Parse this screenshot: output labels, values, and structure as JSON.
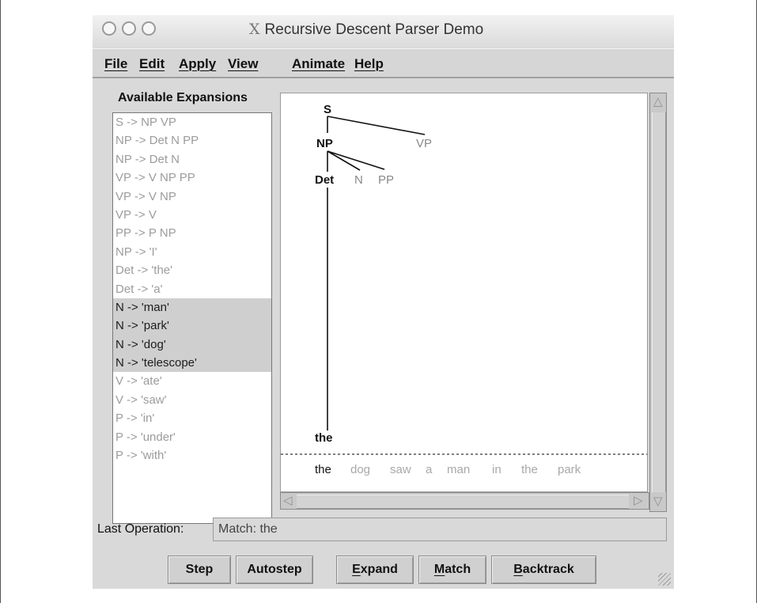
{
  "window": {
    "title": "Recursive Descent Parser Demo",
    "title_icon": "X"
  },
  "menubar": [
    {
      "label": "File"
    },
    {
      "label": "Edit"
    },
    {
      "label": "Apply"
    },
    {
      "label": "View"
    },
    {
      "label": "Animate"
    },
    {
      "label": "Help"
    }
  ],
  "expansions": {
    "title": "Available Expansions",
    "items": [
      {
        "label": "S -> NP VP",
        "highlighted": false
      },
      {
        "label": "NP -> Det N PP",
        "highlighted": false
      },
      {
        "label": "NP -> Det N",
        "highlighted": false
      },
      {
        "label": "VP -> V NP PP",
        "highlighted": false
      },
      {
        "label": "VP -> V NP",
        "highlighted": false
      },
      {
        "label": "VP -> V",
        "highlighted": false
      },
      {
        "label": "PP -> P NP",
        "highlighted": false
      },
      {
        "label": "NP -> 'I'",
        "highlighted": false
      },
      {
        "label": "Det -> 'the'",
        "highlighted": false
      },
      {
        "label": "Det -> 'a'",
        "highlighted": false
      },
      {
        "label": "N -> 'man'",
        "highlighted": true
      },
      {
        "label": "N -> 'park'",
        "highlighted": true
      },
      {
        "label": "N -> 'dog'",
        "highlighted": true
      },
      {
        "label": "N -> 'telescope'",
        "highlighted": true
      },
      {
        "label": "V -> 'ate'",
        "highlighted": false
      },
      {
        "label": "V -> 'saw'",
        "highlighted": false
      },
      {
        "label": "P -> 'in'",
        "highlighted": false
      },
      {
        "label": "P -> 'under'",
        "highlighted": false
      },
      {
        "label": "P -> 'with'",
        "highlighted": false
      }
    ]
  },
  "tree": {
    "nodes": {
      "s": "S",
      "np": "NP",
      "vp": "VP",
      "det": "Det",
      "n": "N",
      "pp": "PP",
      "the": "the"
    },
    "sentence": [
      {
        "word": "the",
        "matched": true
      },
      {
        "word": "dog",
        "matched": false
      },
      {
        "word": "saw",
        "matched": false
      },
      {
        "word": "a",
        "matched": false
      },
      {
        "word": "man",
        "matched": false
      },
      {
        "word": "in",
        "matched": false
      },
      {
        "word": "the",
        "matched": false
      },
      {
        "word": "park",
        "matched": false
      }
    ]
  },
  "status": {
    "label": "Last Operation:",
    "value": "Match: the"
  },
  "buttons": {
    "step": "Step",
    "autostep": "Autostep",
    "expand_pre": "",
    "expand_u": "E",
    "expand_post": "xpand",
    "match_pre": "",
    "match_u": "M",
    "match_post": "atch",
    "backtrack_pre": "",
    "backtrack_u": "B",
    "backtrack_post": "acktrack"
  },
  "colors": {
    "matched": "#111111",
    "unmatched": "#a8a8a8",
    "highlight": "#cfcfcf"
  }
}
